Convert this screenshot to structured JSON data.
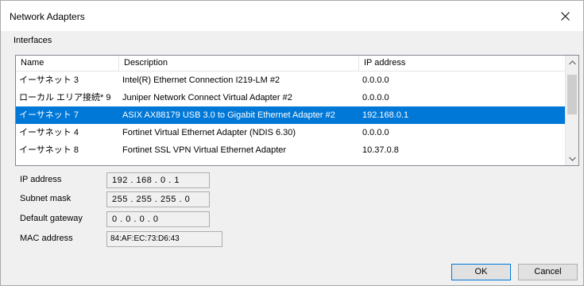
{
  "window": {
    "title": "Network Adapters"
  },
  "interfaces": {
    "group_label": "Interfaces",
    "columns": [
      "Name",
      "Description",
      "IP address"
    ],
    "rows": [
      {
        "name": "イーサネット 3",
        "description": "Intel(R) Ethernet Connection I219-LM #2",
        "ip": "0.0.0.0"
      },
      {
        "name": "ローカル エリア接続* 9",
        "description": "Juniper Network Connect Virtual Adapter #2",
        "ip": "0.0.0.0"
      },
      {
        "name": "イーサネット 7",
        "description": "ASIX AX88179 USB 3.0 to Gigabit Ethernet Adapter #2",
        "ip": "192.168.0.1",
        "selected": true
      },
      {
        "name": "イーサネット 4",
        "description": "Fortinet Virtual Ethernet Adapter (NDIS 6.30)",
        "ip": "0.0.0.0"
      },
      {
        "name": "イーサネット 8",
        "description": "Fortinet SSL VPN Virtual Ethernet Adapter",
        "ip": "10.37.0.8"
      }
    ]
  },
  "fields": {
    "ip_address": {
      "label": "IP address",
      "value": "192 . 168 . 0 . 1"
    },
    "subnet_mask": {
      "label": "Subnet mask",
      "value": "255 . 255 . 255 . 0"
    },
    "default_gateway": {
      "label": "Default gateway",
      "value": "0 . 0 . 0 . 0"
    },
    "mac_address": {
      "label": "MAC address",
      "value": "84:AF:EC:73:D6:43"
    }
  },
  "buttons": {
    "ok": "OK",
    "cancel": "Cancel"
  },
  "colors": {
    "selection": "#0078d7"
  }
}
